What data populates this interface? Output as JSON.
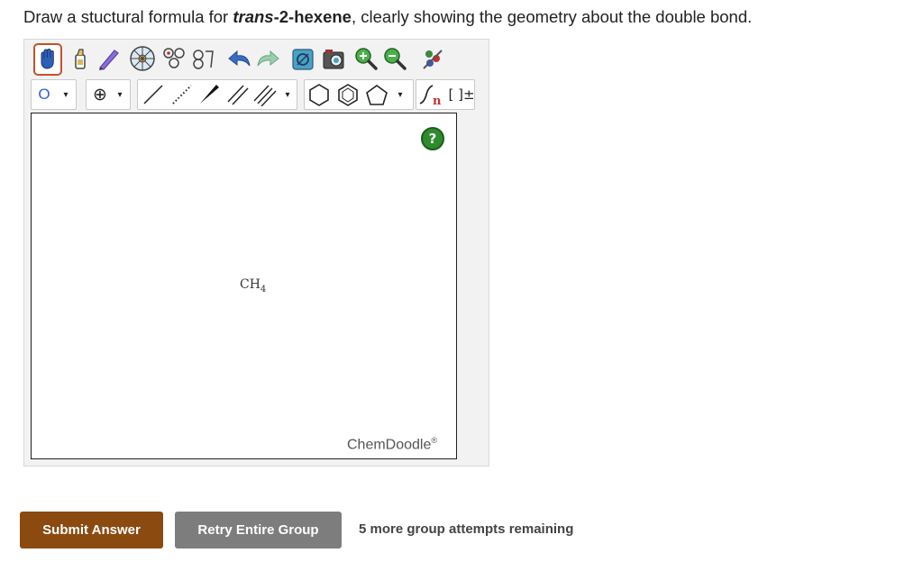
{
  "question": {
    "prefix": "Draw a stuctural formula for ",
    "compound_italic": "trans",
    "compound_rest": "-2-hexene",
    "suffix": ", clearly showing the geometry about the double bond."
  },
  "toolbar": {
    "row1": [
      "hand-tool",
      "eraser-tool",
      "lasso-tool",
      "ring-template-tool",
      "chain-template-tool",
      "undo",
      "redo",
      "clean-2d",
      "clean-3d",
      "zoom-in",
      "zoom-out",
      "settings"
    ],
    "atom_label": "O",
    "charge_label": "⊕",
    "ring_dropdown": "▾",
    "sgroup_label": "n",
    "bracket_label": "[ ]±"
  },
  "canvas": {
    "molecule_text": "CH",
    "molecule_subscript": "4",
    "help_label": "?",
    "brand_name": "ChemDoodle",
    "brand_mark": "®"
  },
  "actions": {
    "submit_label": "Submit Answer",
    "retry_label": "Retry Entire Group",
    "attempts_text": "5 more group attempts remaining"
  },
  "colors": {
    "submit_bg": "#8a4a10",
    "retry_bg": "#7d7d7d",
    "help_bg": "#2e8b2e",
    "selected_border": "#c8502a"
  }
}
